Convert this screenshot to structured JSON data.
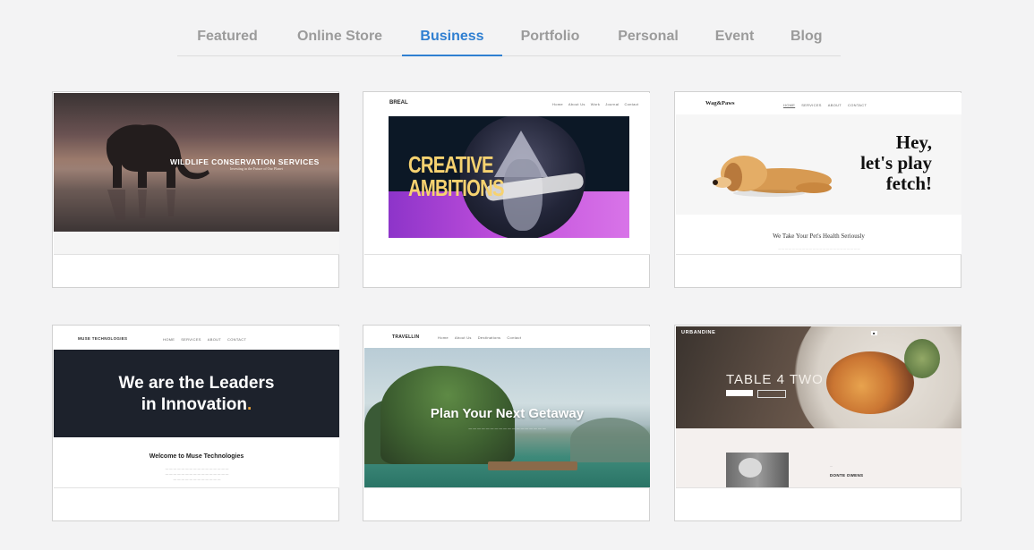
{
  "tabs": [
    {
      "label": "Featured",
      "active": false
    },
    {
      "label": "Online Store",
      "active": false
    },
    {
      "label": "Business",
      "active": true
    },
    {
      "label": "Portfolio",
      "active": false
    },
    {
      "label": "Personal",
      "active": false
    },
    {
      "label": "Event",
      "active": false
    },
    {
      "label": "Blog",
      "active": false
    }
  ],
  "templates": {
    "wildlife": {
      "headline": "WILDLIFE CONSERVATION SERVICES",
      "subtitle": "Investing in the Future of Our Planet"
    },
    "breal": {
      "logo": "BREAL",
      "nav": [
        "Home",
        "About Us",
        "Work",
        "Journal",
        "Contact"
      ],
      "headline_1": "CREATIVE",
      "headline_2": "AMBITIONS"
    },
    "wagpaws": {
      "logo": "Wag&Paws",
      "nav": [
        "HOME",
        "SERVICES",
        "ABOUT",
        "CONTACT"
      ],
      "hero_1": "Hey,",
      "hero_2": "let's play",
      "hero_3": "fetch!",
      "tagline": "We Take Your Pet's Health Seriously"
    },
    "muse": {
      "logo": "MUSE TECHNOLOGIES",
      "nav": [
        "HOME",
        "SERVICES",
        "ABOUT",
        "CONTACT"
      ],
      "lead_1": "We are the Leaders",
      "lead_2": "in Innovation",
      "lead_dot": ".",
      "welcome": "Welcome to Muse Technologies"
    },
    "travellin": {
      "logo": "TRAVELLIN",
      "nav": [
        "Home",
        "About Us",
        "Destinations",
        "Contact"
      ],
      "headline": "Plan Your Next Getaway"
    },
    "urbandine": {
      "logo": "URBANDINE",
      "title": "TABLE 4 TWO",
      "chef_name": "DONTE OWENS"
    }
  }
}
